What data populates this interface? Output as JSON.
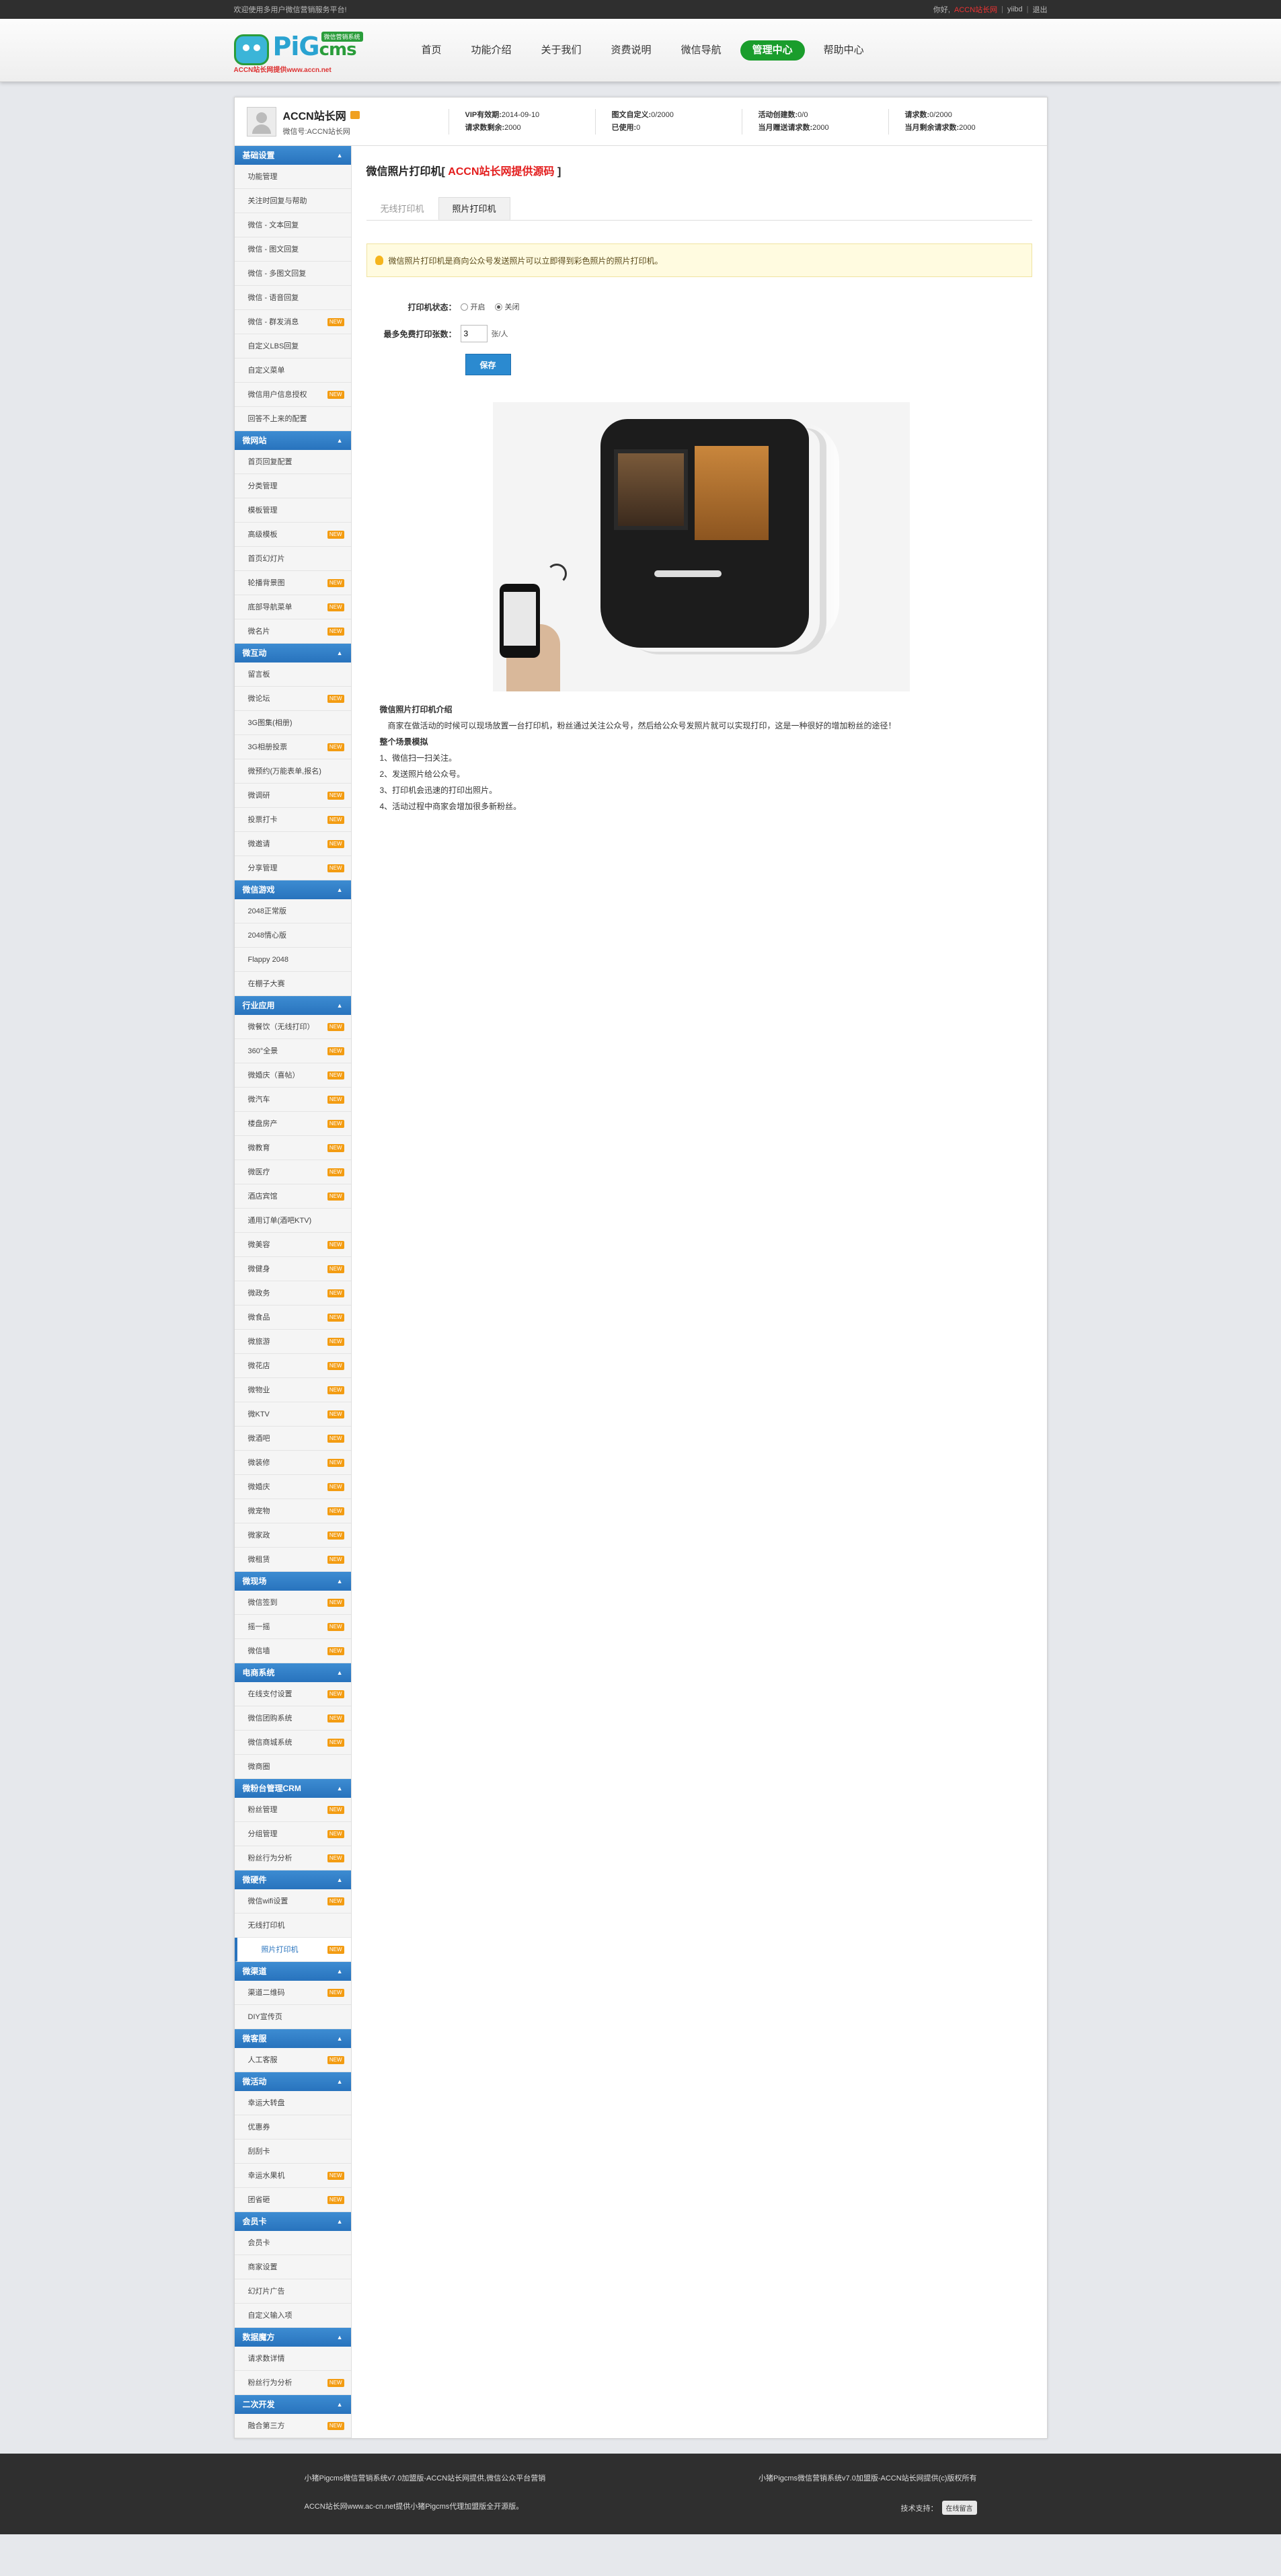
{
  "topbar": {
    "welcome": "欢迎使用多用户微信营销服务平台!",
    "greeting": "你好,",
    "username": "ACCN站长网",
    "separator": "|",
    "phone_link": "yiibd",
    "logout": "退出"
  },
  "logo": {
    "badge": "微信营销系统",
    "wordmark_main": "PiG",
    "wordmark_sub": "cms",
    "tagline": "ACCN站长网提供www.accn.net"
  },
  "nav": [
    "首页",
    "功能介绍",
    "关于我们",
    "资费说明",
    "微信导航",
    "管理中心",
    "帮助中心"
  ],
  "nav_active": "管理中心",
  "account": {
    "name": "ACCN站长网",
    "sub": "微信号:ACCN站长网",
    "stats": [
      [
        "VIP有效期:",
        "2014-09-10",
        "请求数剩余:",
        "2000"
      ],
      [
        "图文自定义:",
        "0/2000",
        "已使用:",
        "0"
      ],
      [
        "活动创建数:",
        "0/0",
        "当月赠送请求数:",
        "2000"
      ],
      [
        "请求数:",
        "0/2000",
        "当月剩余请求数:",
        "2000"
      ]
    ]
  },
  "sidebar": [
    {
      "title": "基础设置",
      "items": [
        [
          "功能管理",
          false
        ],
        [
          "关注时回复与帮助",
          false
        ],
        [
          "微信 - 文本回复",
          false
        ],
        [
          "微信 - 图文回复",
          false
        ],
        [
          "微信 - 多图文回复",
          false
        ],
        [
          "微信 - 语音回复",
          false
        ],
        [
          "微信 - 群发消息",
          true
        ],
        [
          "自定义LBS回复",
          false
        ],
        [
          "自定义菜单",
          false
        ],
        [
          "微信用户信息授权",
          true
        ],
        [
          "回答不上来的配置",
          false
        ]
      ]
    },
    {
      "title": "微网站",
      "items": [
        [
          "首页回复配置",
          false
        ],
        [
          "分类管理",
          false
        ],
        [
          "模板管理",
          false
        ],
        [
          "高级模板",
          true
        ],
        [
          "首页幻灯片",
          false
        ],
        [
          "轮播背景图",
          true
        ],
        [
          "底部导航菜单",
          true
        ],
        [
          "微名片",
          true
        ]
      ]
    },
    {
      "title": "微互动",
      "items": [
        [
          "留言板",
          false
        ],
        [
          "微论坛",
          true
        ],
        [
          "3G图集(相册)",
          false
        ],
        [
          "3G相册投票",
          true
        ],
        [
          "微预约(万能表单,报名)",
          false
        ],
        [
          "微调研",
          true
        ],
        [
          "投票打卡",
          true
        ],
        [
          "微邀请",
          true
        ],
        [
          "分享管理",
          true
        ]
      ]
    },
    {
      "title": "微信游戏",
      "items": [
        [
          "2048正常版",
          false
        ],
        [
          "2048情心版",
          false
        ],
        [
          "Flappy 2048",
          false
        ],
        [
          "在棚子大赛",
          false
        ]
      ]
    },
    {
      "title": "行业应用",
      "items": [
        [
          "微餐饮（无线打印）",
          true
        ],
        [
          "360°全景",
          true
        ],
        [
          "微婚庆（喜帖）",
          true
        ],
        [
          "微汽车",
          true
        ],
        [
          "楼盘房产",
          true
        ],
        [
          "微教育",
          true
        ],
        [
          "微医疗",
          true
        ],
        [
          "酒店宾馆",
          true
        ],
        [
          "通用订单(酒吧KTV)",
          false
        ],
        [
          "微美容",
          true
        ],
        [
          "微健身",
          true
        ],
        [
          "微政务",
          true
        ],
        [
          "微食品",
          true
        ],
        [
          "微旅游",
          true
        ],
        [
          "微花店",
          true
        ],
        [
          "微物业",
          true
        ],
        [
          "微KTV",
          true
        ],
        [
          "微酒吧",
          true
        ],
        [
          "微装修",
          true
        ],
        [
          "微婚庆",
          true
        ],
        [
          "微宠物",
          true
        ],
        [
          "微家政",
          true
        ],
        [
          "微租赁",
          true
        ]
      ]
    },
    {
      "title": "微现场",
      "items": [
        [
          "微信签到",
          true
        ],
        [
          "摇一摇",
          true
        ],
        [
          "微信墙",
          true
        ]
      ]
    },
    {
      "title": "电商系统",
      "items": [
        [
          "在线支付设置",
          true
        ],
        [
          "微信团购系统",
          true
        ],
        [
          "微信商城系统",
          true
        ],
        [
          "微商圈",
          false
        ]
      ]
    },
    {
      "title": "微粉台管理CRM",
      "items": [
        [
          "粉丝管理",
          true
        ],
        [
          "分组管理",
          true
        ],
        [
          "粉丝行为分析",
          true
        ]
      ]
    },
    {
      "title": "微硬件",
      "items": [
        [
          "微信wifi设置",
          true
        ],
        [
          "无线打印机",
          false
        ],
        [
          "照片打印机",
          true
        ]
      ]
    },
    {
      "title": "微渠道",
      "items": [
        [
          "渠道二维码",
          true
        ],
        [
          "DIY宣传页",
          false
        ]
      ]
    },
    {
      "title": "微客服",
      "items": [
        [
          "人工客服",
          true
        ]
      ]
    },
    {
      "title": "微活动",
      "items": [
        [
          "幸运大转盘",
          false
        ],
        [
          "优惠券",
          false
        ],
        [
          "刮刮卡",
          false
        ],
        [
          "幸运水果机",
          true
        ],
        [
          "团省砸",
          true
        ]
      ]
    },
    {
      "title": "会员卡",
      "items": [
        [
          "会员卡",
          false
        ],
        [
          "商家设置",
          false
        ],
        [
          "幻灯片广告",
          false
        ],
        [
          "自定义输入项",
          false
        ]
      ]
    },
    {
      "title": "数据魔方",
      "items": [
        [
          "请求数详情",
          false
        ],
        [
          "粉丝行为分析",
          true
        ]
      ]
    },
    {
      "title": "二次开发",
      "items": [
        [
          "融合第三方",
          true
        ]
      ]
    }
  ],
  "sidebar_active": "照片打印机",
  "main": {
    "title_prefix": "微信照片打印机[",
    "title_brand": " ACCN站长网提供源码 ",
    "title_suffix": "]",
    "tabs": [
      "无线打印机",
      "照片打印机"
    ],
    "active_tab": "照片打印机",
    "notice": "微信照片打印机是商向公众号发送照片可以立即得到彩色照片的照片打印机。",
    "form": {
      "status_label": "打印机状态：",
      "status_on": "开启",
      "status_off": "关闭",
      "status_value": "关闭",
      "limit_label": "最多免费打印张数：",
      "limit_value": "3",
      "limit_unit": "张/人",
      "save": "保存"
    },
    "intro": {
      "heading": "微信照片打印机介绍",
      "desc": "商家在做活动的时候可以现场放置一台打印机，粉丝通过关注公众号，然后给公众号发照片就可以实现打印，这是一种很好的增加粉丝的途径！",
      "flow_heading": "整个场景模拟",
      "steps": [
        "1、微信扫一扫关注。",
        "2、发送照片给公众号。",
        "3、打印机会迅速的打印出照片。",
        "4、活动过程中商家会增加很多新粉丝。"
      ]
    }
  },
  "footer": {
    "left_1": "小猪Pigcms微信营销系统v7.0加盟版-ACCN站长网提供,微信公众平台营销",
    "left_2": "ACCN站长网www.ac-cn.net提供小猪Pigcms代理加盟版全开源版。",
    "right_1": "小猪Pigcms微信营销系统v7.0加盟版-ACCN站长网提供(c)版权所有",
    "right_2": "技术支持：",
    "tech_badge": "在线留言"
  },
  "colors": {
    "accent_blue": "#2873bd",
    "nav_active_green": "#1a9d2c",
    "brand_red": "#e31c1c",
    "new_tag": "#f39c12"
  }
}
